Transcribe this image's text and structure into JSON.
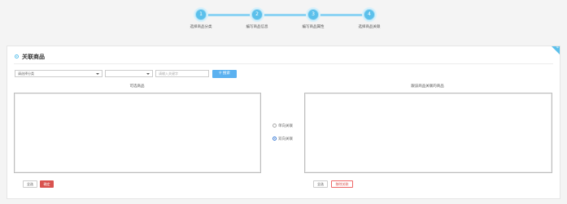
{
  "steps": [
    {
      "number": "1",
      "label": "选择商品分类"
    },
    {
      "number": "2",
      "label": "编写商品信息"
    },
    {
      "number": "3",
      "label": "编写商品属性"
    },
    {
      "number": "4",
      "label": "选择商品关联"
    }
  ],
  "panel": {
    "title": "关联商品",
    "corner_badge": "tip"
  },
  "filters": {
    "category_select": "请选择分类",
    "secondary_select": "",
    "keyword_placeholder": "请输入关键字",
    "search_label": "搜索"
  },
  "lists": {
    "available_title": "可选商品",
    "linked_title": "跟该商品关联的商品"
  },
  "relation": {
    "options": [
      "单向关联",
      "双向关联"
    ],
    "selected": "双向关联"
  },
  "buttons": {
    "select_all_left": "全选",
    "confirm": "确定",
    "select_all_right": "全选",
    "remove": "移除关联"
  },
  "colors": {
    "accent": "#5bc0eb",
    "danger": "#d9534f",
    "primary_button": "#5bb1f0"
  }
}
